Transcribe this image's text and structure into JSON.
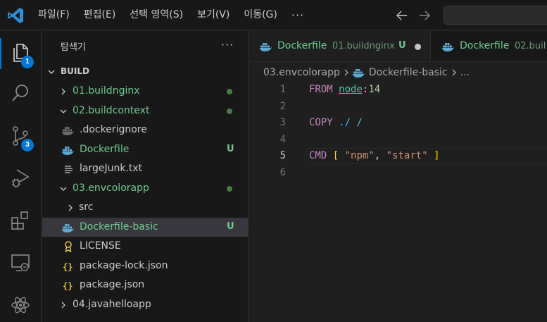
{
  "menu": [
    "파일(F)",
    "편집(E)",
    "선택 영역(S)",
    "보기(V)",
    "이동(G)"
  ],
  "menu_more": "···",
  "activity": {
    "explorer_badge": "1",
    "scm_badge": "3"
  },
  "sidebar": {
    "title": "탐색기",
    "more": "···",
    "section": "BUILD",
    "rows": [
      {
        "label": "01.buildnginx",
        "status": ""
      },
      {
        "label": "02.buildcontext",
        "status": ""
      },
      {
        "label": ".dockerignore",
        "status": ""
      },
      {
        "label": "Dockerfile",
        "status": "U"
      },
      {
        "label": "largeJunk.txt",
        "status": ""
      },
      {
        "label": "03.envcolorapp",
        "status": ""
      },
      {
        "label": "src",
        "status": ""
      },
      {
        "label": "Dockerfile-basic",
        "status": "U"
      },
      {
        "label": "LICENSE",
        "status": ""
      },
      {
        "label": "package-lock.json",
        "status": ""
      },
      {
        "label": "package.json",
        "status": ""
      },
      {
        "label": "04.javahelloapp",
        "status": ""
      }
    ]
  },
  "tabs": [
    {
      "name": "Dockerfile",
      "dir": "01.buildnginx",
      "status": "U"
    },
    {
      "name": "Dockerfile",
      "dir": "02.buil"
    }
  ],
  "breadcrumb": {
    "folder": "03.envcolorapp",
    "file": "Dockerfile-basic",
    "tail": "..."
  },
  "code": {
    "line_numbers": [
      "1",
      "2",
      "3",
      "4",
      "5",
      "6"
    ],
    "l1": {
      "kw": "FROM",
      "image": "node",
      "colon": ":",
      "tag": "14"
    },
    "l3": {
      "kw": "COPY",
      "src": "./",
      "dst": "/"
    },
    "l5": {
      "kw": "CMD",
      "open": "[",
      "a": "\"npm\"",
      "comma": ",",
      "b": "\"start\"",
      "close": "]"
    }
  },
  "colors": {
    "accent": "#0078d4",
    "git_untracked": "#73c991",
    "keyword": "#c586c0",
    "string": "#ce9178"
  }
}
